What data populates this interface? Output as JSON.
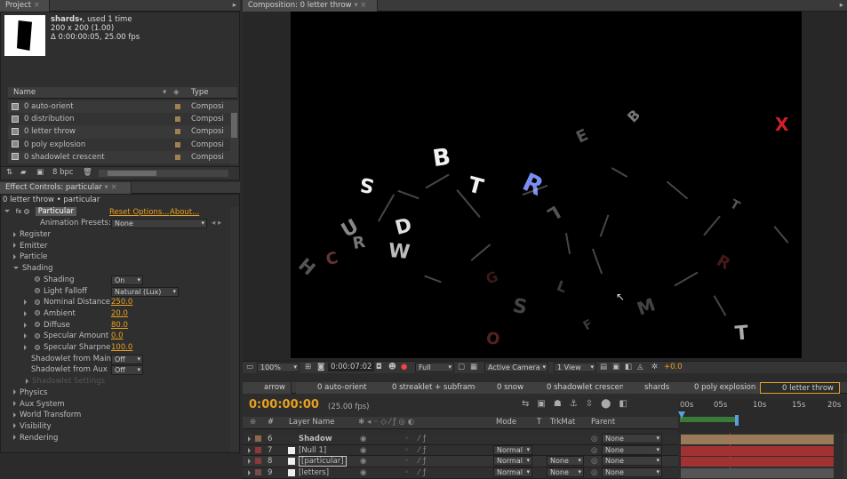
{
  "project": {
    "tab": "Project",
    "item_name": "shards",
    "item_used": ", used 1 time",
    "item_size": "200 x 200 (1.00)",
    "item_duration": "Δ 0:00:00:05, 25.00 fps",
    "col_name": "Name",
    "col_type": "Type",
    "items": [
      {
        "name": "0 auto-orient",
        "type": "Composi"
      },
      {
        "name": "0 distribution",
        "type": "Composi"
      },
      {
        "name": "0 letter throw",
        "type": "Composi"
      },
      {
        "name": "0 poly explosion",
        "type": "Composi"
      },
      {
        "name": "0 shadowlet crescent",
        "type": "Composi"
      }
    ],
    "bpc": "8 bpc"
  },
  "effect_controls": {
    "tab": "Effect Controls: particular",
    "context": "0 letter throw • particular",
    "fx_name": "Particular",
    "reset": "Reset Options...",
    "about": "About...",
    "presets_label": "Animation Presets:",
    "presets_value": "None",
    "groups": [
      "Register",
      "Emitter",
      "Particle",
      "Shading"
    ],
    "shading_props": [
      {
        "label": "Shading",
        "value": "On",
        "kind": "dd"
      },
      {
        "label": "Light Falloff",
        "value": "Natural (Lux)",
        "kind": "dd"
      },
      {
        "label": "Nominal Distance",
        "value": "250.0",
        "kind": "num"
      },
      {
        "label": "Ambient",
        "value": "20.0",
        "kind": "num"
      },
      {
        "label": "Diffuse",
        "value": "80.0",
        "kind": "num"
      },
      {
        "label": "Specular Amount",
        "value": "0.0",
        "kind": "num"
      },
      {
        "label": "Specular Sharpne",
        "value": "100.0",
        "kind": "num"
      }
    ],
    "shadow_main_label": "Shadowlet from Main",
    "shadow_main_value": "Off",
    "shadow_aux_label": "Shadowlet from Aux",
    "shadow_aux_value": "Off",
    "shadow_settings": "Shadowlet Settings",
    "groups_after": [
      "Physics",
      "Aux System",
      "World Transform",
      "Visibility",
      "Rendering"
    ]
  },
  "composition": {
    "tab": "Composition: 0 letter throw",
    "zoom": "100%",
    "timecode": "0:00:07:02",
    "resolution": "Full",
    "camera": "Active Camera",
    "views": "1 View",
    "exposure": "+0.0",
    "letters": [
      {
        "ch": "B",
        "color": "#f2f2f2"
      },
      {
        "ch": "S",
        "color": "#f2f2f2"
      },
      {
        "ch": "T",
        "color": "#f2f2f2"
      },
      {
        "ch": "R",
        "color": "#7a8df0"
      },
      {
        "ch": "D",
        "color": "#e0e0e0"
      },
      {
        "ch": "W",
        "color": "#bbbbbb"
      },
      {
        "ch": "U",
        "color": "#888888"
      },
      {
        "ch": "R",
        "color": "#777777"
      },
      {
        "ch": "X",
        "color": "#d0202a"
      },
      {
        "ch": "E",
        "color": "#555555"
      },
      {
        "ch": "B",
        "color": "#777777"
      },
      {
        "ch": "T",
        "color": "#555555"
      },
      {
        "ch": "M",
        "color": "#444444"
      },
      {
        "ch": "S",
        "color": "#444444"
      },
      {
        "ch": "L",
        "color": "#555555"
      },
      {
        "ch": "H",
        "color": "#555555"
      },
      {
        "ch": "C",
        "color": "#663333"
      },
      {
        "ch": "T",
        "color": "#aaaaaa"
      },
      {
        "ch": "O",
        "color": "#552222"
      },
      {
        "ch": "R",
        "color": "#441818"
      },
      {
        "ch": "G",
        "color": "#3a1a1a"
      },
      {
        "ch": "F",
        "color": "#3a3a3a"
      },
      {
        "ch": "L",
        "color": "#3a3a3a"
      }
    ]
  },
  "timeline": {
    "tabs": [
      "arrow",
      "0 auto-orient",
      "0 streaklet + subframe",
      "0 snow",
      "0 shadowlet crescent",
      "shards",
      "0 poly explosion",
      "0 letter throw"
    ],
    "current_time": "0:00:00:00",
    "fps": "(25.00 fps)",
    "col_num": "#",
    "col_layer": "Layer Name",
    "col_mode": "Mode",
    "col_t": "T",
    "col_trkmat": "TrkMat",
    "col_parent": "Parent",
    "ruler": [
      "00s",
      "05s",
      "10s",
      "15s",
      "20s"
    ],
    "layers": [
      {
        "num": "6",
        "name": "Shadow",
        "mode": "",
        "trkmat": "",
        "parent": "None",
        "swatch": "#8a6a4a",
        "bar": "#9b7a5a"
      },
      {
        "num": "7",
        "name": "[Null 1]",
        "mode": "Normal",
        "trkmat": "",
        "parent": "None",
        "swatch": "#8a3a3a",
        "bar": "#a23232"
      },
      {
        "num": "8",
        "name": "[particular]",
        "mode": "Normal",
        "trkmat": "None",
        "parent": "None",
        "swatch": "#8a3a3a",
        "bar": "#a23232"
      },
      {
        "num": "9",
        "name": "[letters]",
        "mode": "Normal",
        "trkmat": "None",
        "parent": "None",
        "swatch": "#7a4a4a",
        "bar": "#555555"
      }
    ]
  }
}
